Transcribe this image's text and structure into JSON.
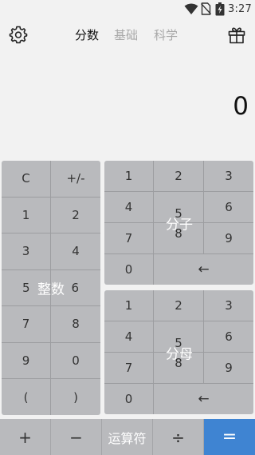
{
  "status_bar": {
    "time": "3:27"
  },
  "header": {
    "tabs": [
      {
        "label": "分数",
        "active": true
      },
      {
        "label": "基础",
        "active": false
      },
      {
        "label": "科学",
        "active": false
      }
    ]
  },
  "display": {
    "value": "0"
  },
  "integer_pad": {
    "label": "整数",
    "keys": [
      "C",
      "+/-",
      "1",
      "2",
      "3",
      "4",
      "5",
      "6",
      "7",
      "8",
      "9",
      "0",
      "(",
      ")"
    ]
  },
  "numerator_pad": {
    "label": "分子",
    "keys": [
      "1",
      "2",
      "3",
      "4",
      "5",
      "6",
      "7",
      "8",
      "9",
      "0",
      "←"
    ]
  },
  "denominator_pad": {
    "label": "分母",
    "keys": [
      "1",
      "2",
      "3",
      "4",
      "5",
      "6",
      "7",
      "8",
      "9",
      "0",
      "←"
    ]
  },
  "bottom_bar": {
    "plus": "+",
    "minus": "−",
    "operators_label": "运算符",
    "divide": "÷",
    "equals": "="
  },
  "colors": {
    "keypad_background": "#b9babd",
    "equals_button": "#3f84d2",
    "screen_background": "#f2f2f2"
  }
}
